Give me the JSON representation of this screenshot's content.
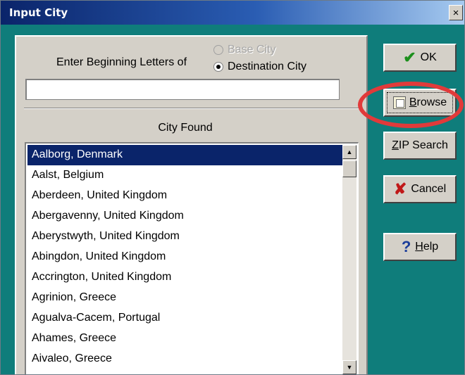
{
  "window": {
    "title": "Input City",
    "close_label": "×"
  },
  "prompt": {
    "label": "Enter Beginning Letters of",
    "options": [
      {
        "label": "Base City",
        "checked": false,
        "enabled": false
      },
      {
        "label": "Destination City",
        "checked": true,
        "enabled": true
      }
    ]
  },
  "search": {
    "value": "",
    "placeholder": ""
  },
  "results": {
    "label": "City Found",
    "items": [
      "Aalborg, Denmark",
      "Aalst, Belgium",
      "Aberdeen, United Kingdom",
      "Abergavenny, United Kingdom",
      "Aberystwyth, United Kingdom",
      "Abingdon, United Kingdom",
      "Accrington, United Kingdom",
      "Agrinion, Greece",
      "Agualva-Cacem, Portugal",
      "Ahames, Greece",
      "Aivaleo, Greece"
    ],
    "selected_index": 0
  },
  "buttons": {
    "ok": {
      "icon": "check-icon",
      "label": "OK"
    },
    "browse": {
      "icon": "browse-icon",
      "prefix": "",
      "accel": "B",
      "rest": "rowse"
    },
    "zip": {
      "accel": "Z",
      "rest": "IP Search"
    },
    "cancel": {
      "icon": "x-icon",
      "label": "Cancel"
    },
    "help": {
      "icon": "question-icon",
      "accel": "H",
      "rest": "elp"
    }
  },
  "colors": {
    "window_bg": "#0f7d7b",
    "selection": "#0a246a",
    "highlight_ring": "#e13a3a"
  }
}
